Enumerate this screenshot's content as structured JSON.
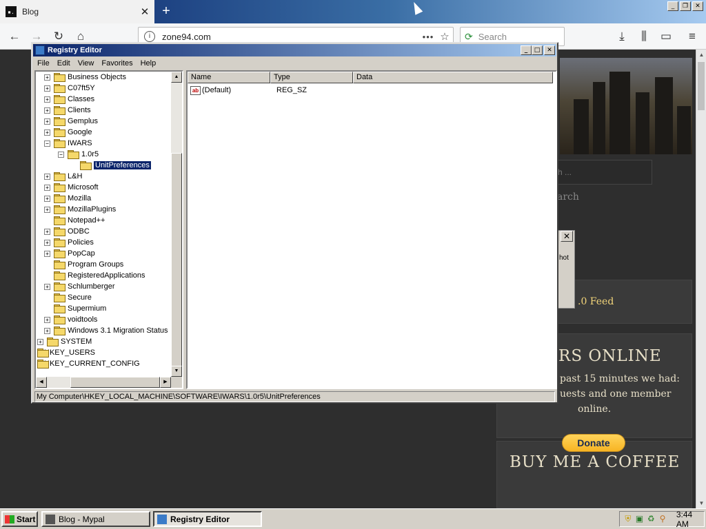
{
  "browser": {
    "tab_title": "Blog",
    "tab_close": "✕",
    "new_tab": "+",
    "url": "zone94.com",
    "url_dots": "•••",
    "search_placeholder": "Search"
  },
  "webpage": {
    "search_stub": "rch ...",
    "search_btn_stub": "arch",
    "feed_stub": ".0 Feed",
    "dialog_fragment": "hot",
    "users_heading_stub": "RS ONLINE",
    "users_text_1": "past 15 minutes we had:",
    "users_text_2": "uests and one member",
    "users_text_3": "online.",
    "coffee_heading": "BUY ME A COFFEE",
    "donate_label": "Donate"
  },
  "regedit": {
    "title": "Registry Editor",
    "menu": [
      "File",
      "Edit",
      "View",
      "Favorites",
      "Help"
    ],
    "tree": [
      {
        "label": "Business Objects",
        "exp": "+",
        "level": 2
      },
      {
        "label": "C07ft5Y",
        "exp": "+",
        "level": 2
      },
      {
        "label": "Classes",
        "exp": "+",
        "level": 2
      },
      {
        "label": "Clients",
        "exp": "+",
        "level": 2
      },
      {
        "label": "Gemplus",
        "exp": "+",
        "level": 2
      },
      {
        "label": "Google",
        "exp": "+",
        "level": 2
      },
      {
        "label": "IWARS",
        "exp": "-",
        "level": 2
      },
      {
        "label": "1.0r5",
        "exp": "-",
        "level": 3
      },
      {
        "label": "UnitPreferences",
        "exp": "",
        "level": 4,
        "selected": true
      },
      {
        "label": "L&H",
        "exp": "+",
        "level": 2
      },
      {
        "label": "Microsoft",
        "exp": "+",
        "level": 2
      },
      {
        "label": "Mozilla",
        "exp": "+",
        "level": 2
      },
      {
        "label": "MozillaPlugins",
        "exp": "+",
        "level": 2
      },
      {
        "label": "Notepad++",
        "exp": "",
        "level": 2
      },
      {
        "label": "ODBC",
        "exp": "+",
        "level": 2
      },
      {
        "label": "Policies",
        "exp": "+",
        "level": 2
      },
      {
        "label": "PopCap",
        "exp": "+",
        "level": 2
      },
      {
        "label": "Program Groups",
        "exp": "",
        "level": 2
      },
      {
        "label": "RegisteredApplications",
        "exp": "",
        "level": 2
      },
      {
        "label": "Schlumberger",
        "exp": "+",
        "level": 2
      },
      {
        "label": "Secure",
        "exp": "",
        "level": 2
      },
      {
        "label": "Supermium",
        "exp": "",
        "level": 2
      },
      {
        "label": "voidtools",
        "exp": "+",
        "level": 2
      },
      {
        "label": "Windows 3.1 Migration Status",
        "exp": "+",
        "level": 2
      },
      {
        "label": "SYSTEM",
        "exp": "+",
        "level": 1
      },
      {
        "label": "HKEY_USERS",
        "exp": "",
        "level": 0
      },
      {
        "label": "HKEY_CURRENT_CONFIG",
        "exp": "",
        "level": 0
      }
    ],
    "columns": {
      "name": "Name",
      "type": "Type",
      "data": "Data"
    },
    "values": [
      {
        "name": "(Default)",
        "type": "REG_SZ",
        "data": "",
        "icon": "ab"
      }
    ],
    "status_path": "My Computer\\HKEY_LOCAL_MACHINE\\SOFTWARE\\IWARS\\1.0r5\\UnitPreferences"
  },
  "taskbar": {
    "start": "Start",
    "items": [
      {
        "label": "Blog - Mypal",
        "active": false
      },
      {
        "label": "Registry Editor",
        "active": true
      }
    ],
    "clock": "3:44 AM"
  },
  "colors": {
    "titlebar": "#0a246a",
    "selection": "#0a246a",
    "face": "#d4d0c8",
    "donate": "#f7b423"
  }
}
